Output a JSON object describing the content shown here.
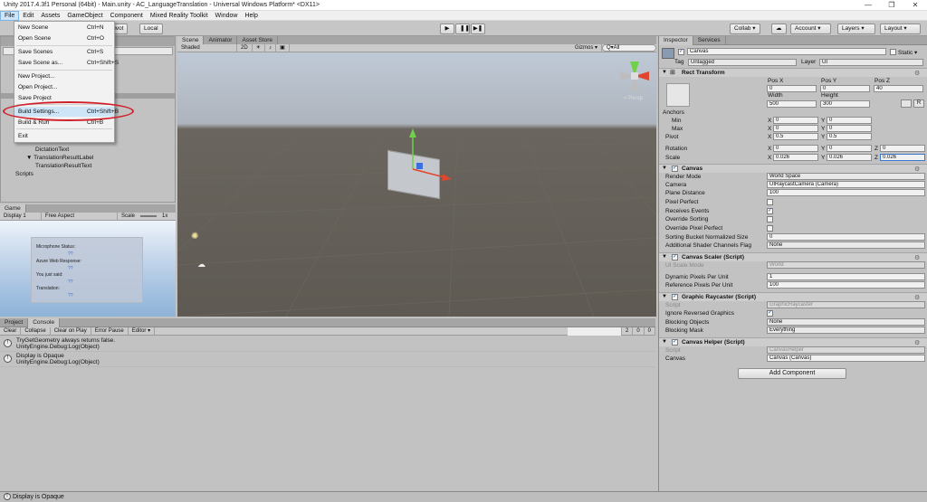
{
  "window": {
    "title": "Unity 2017.4.3f1 Personal (64bit) - Main.unity - AC_LanguageTranslation - Universal Windows Platform* <DX11>",
    "controls": [
      "—",
      "❐",
      "✕"
    ]
  },
  "menubar": [
    "File",
    "Edit",
    "Assets",
    "GameObject",
    "Component",
    "Mixed Reality Toolkit",
    "Window",
    "Help"
  ],
  "file_menu": {
    "items": [
      {
        "label": "New Scene",
        "shortcut": "Ctrl+N"
      },
      {
        "label": "Open Scene",
        "shortcut": "Ctrl+O"
      },
      {
        "label": "Save Scenes",
        "shortcut": "Ctrl+S"
      },
      {
        "label": "Save Scene as...",
        "shortcut": "Ctrl+Shift+S"
      },
      {
        "label": "New Project...",
        "shortcut": ""
      },
      {
        "label": "Open Project...",
        "shortcut": ""
      },
      {
        "label": "Save Project",
        "shortcut": ""
      },
      {
        "label": "Build Settings...",
        "shortcut": "Ctrl+Shift+B"
      },
      {
        "label": "Build & Run",
        "shortcut": "Ctrl+B"
      },
      {
        "label": "Exit",
        "shortcut": ""
      }
    ]
  },
  "toolbar": {
    "pivot": "Pivot",
    "local": "Local",
    "play": "▶",
    "pause": "❚❚",
    "step": "▶❚",
    "collab": "Collab ▾",
    "cloud": "☁",
    "account": "Account ▾",
    "layers": "Layers ▾",
    "layout": "Layout ▾"
  },
  "hierarchy": {
    "items": [
      "DictationText",
      "▼ TranslationResultLabel",
      "TranslationResultText",
      "Scripts"
    ]
  },
  "scene_panel": {
    "tabs": [
      "Scene",
      "Animator",
      "Asset Store"
    ],
    "shaded": "Shaded",
    "mode_2d": "2D",
    "gizmos": "Gizmos ▾",
    "search": "Q▾All",
    "persp": "< Persp"
  },
  "game_panel": {
    "tab": "Game",
    "display": "Display 1",
    "aspect": "Free Aspect",
    "scale_label": "Scale",
    "scale_value": "1x",
    "card": {
      "mic": "Microphone Status:",
      "azure": "Azure Web Response:",
      "said": "You just said:",
      "translation": "Translation:",
      "q": "??"
    }
  },
  "console_panel": {
    "tabs": [
      "Project",
      "Console"
    ],
    "buttons": [
      "Clear",
      "Collapse",
      "Clear on Play",
      "Error Pause",
      "Editor ▾"
    ],
    "counts": [
      "2",
      "0",
      "0"
    ],
    "rows": [
      {
        "line1": "TryGetGeometry always returns false.",
        "line2": "UnityEngine.Debug:Log(Object)"
      },
      {
        "line1": "Display is Opaque",
        "line2": "UnityEngine.Debug:Log(Object)"
      }
    ]
  },
  "status_bar": "Display is Opaque",
  "inspector": {
    "tabs": [
      "Inspector",
      "Services"
    ],
    "object_name": "Canvas",
    "static_label": "Static ▾",
    "tag_label": "Tag",
    "tag_value": "Untagged",
    "layer_label": "Layer",
    "layer_value": "UI",
    "rect_transform": {
      "title": "Rect Transform",
      "posx_label": "Pos X",
      "posy_label": "Pos Y",
      "posz_label": "Pos Z",
      "posx": "0",
      "posy": "0",
      "posz": "40",
      "width_label": "Width",
      "height_label": "Height",
      "width": "500",
      "height": "300",
      "anchors": "Anchors",
      "min": "Min",
      "max": "Max",
      "pivot": "Pivot",
      "rotation": "Rotation",
      "scale": "Scale",
      "min_x": "0",
      "min_y": "0",
      "max_x": "0",
      "max_y": "0",
      "pivot_x": "0.5",
      "pivot_y": "0.5",
      "rot_x": "0",
      "rot_y": "0",
      "rot_z": "0",
      "scale_x": "0.026",
      "scale_y": "0.026",
      "scale_z": "0.026",
      "x": "X",
      "y": "Y",
      "z": "Z"
    },
    "canvas": {
      "title": "Canvas",
      "render_mode_label": "Render Mode",
      "render_mode": "World Space",
      "camera_label": "Camera",
      "camera": "UIRaycastCamera (Camera)",
      "plane_distance_label": "Plane Distance",
      "plane_distance": "100",
      "pixel_perfect_label": "Pixel Perfect",
      "receives_events_label": "Receives Events",
      "override_sorting_label": "Override Sorting",
      "override_pixel_perfect_label": "Override Pixel Perfect",
      "sorting_bucket_label": "Sorting Bucket Normalized Size",
      "sorting_bucket": "0",
      "shader_channels_label": "Additional Shader Channels Flag",
      "shader_channels": "None"
    },
    "canvas_scaler": {
      "title": "Canvas Scaler (Script)",
      "ui_scale_mode_label": "UI Scale Mode",
      "ui_scale_mode": "World",
      "dynamic_label": "Dynamic Pixels Per Unit",
      "dynamic": "1",
      "reference_label": "Reference Pixels Per Unit",
      "reference": "100"
    },
    "graphic_raycaster": {
      "title": "Graphic Raycaster (Script)",
      "script_label": "Script",
      "script": "GraphicRaycaster",
      "ignore_label": "Ignore Reversed Graphics",
      "blocking_objects_label": "Blocking Objects",
      "blocking_objects": "None",
      "blocking_mask_label": "Blocking Mask",
      "blocking_mask": "Everything"
    },
    "canvas_helper": {
      "title": "Canvas Helper (Script)",
      "script_label": "Script",
      "script": "CanvasHelper",
      "canvas_label": "Canvas",
      "canvas": "Canvas (Canvas)"
    },
    "add_component": "Add Component"
  },
  "colors": {
    "highlight": "#cde5f7",
    "annotation_red": "#d0212b",
    "scene_ground": "#5e5a53",
    "sky": "#bfc9d6"
  }
}
